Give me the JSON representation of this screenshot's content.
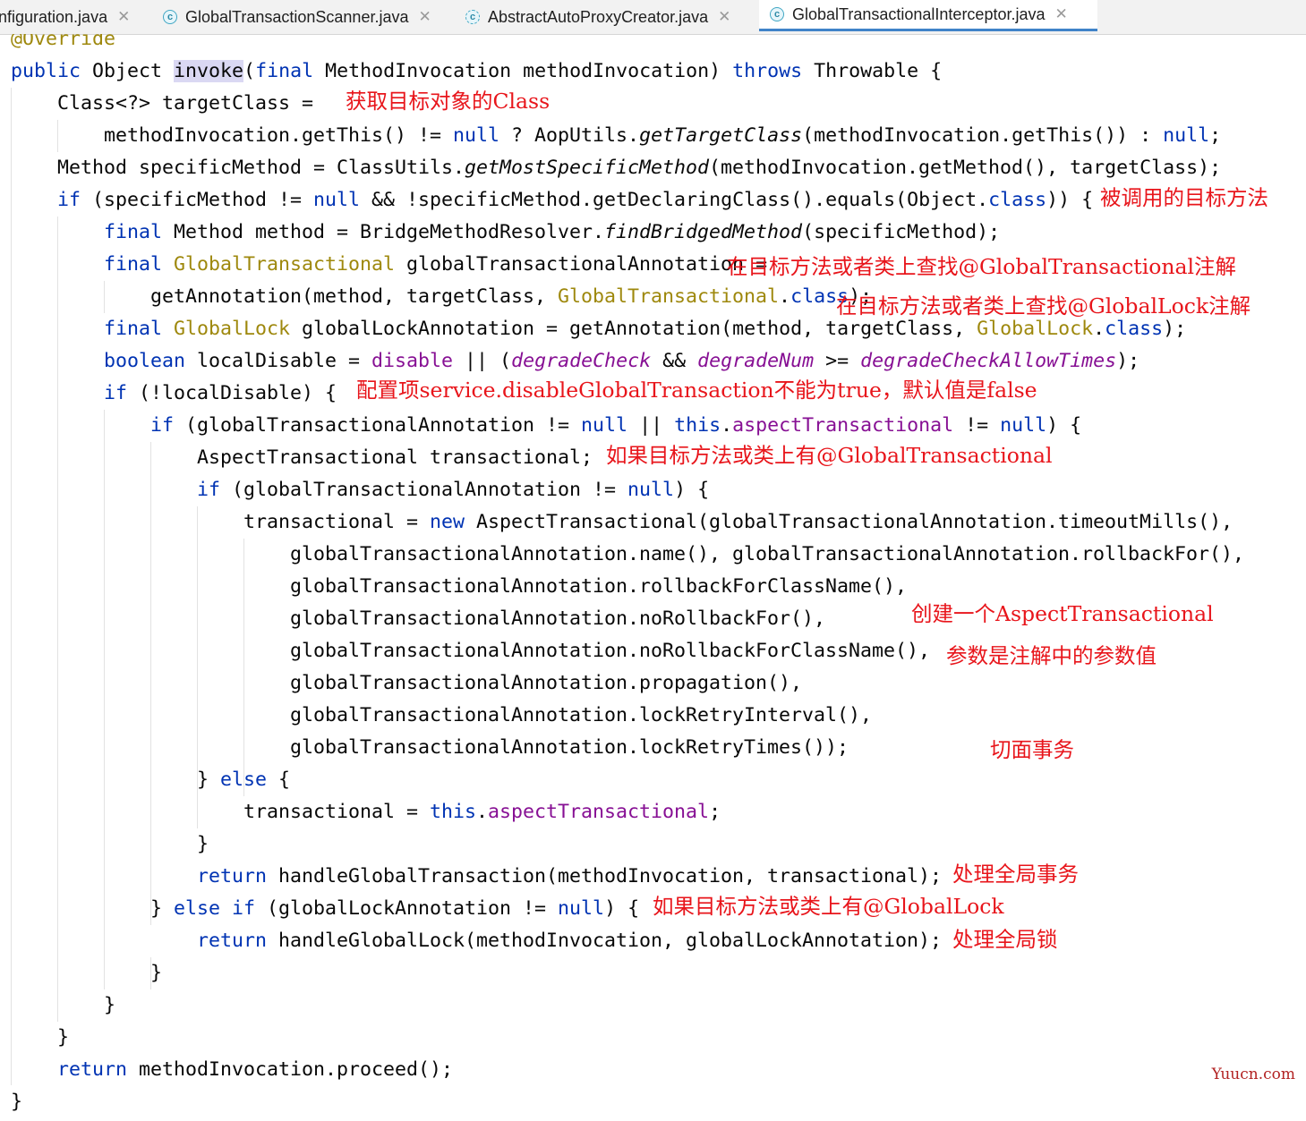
{
  "tabs": [
    {
      "label": "nfiguration.java",
      "icon": "none",
      "active": false
    },
    {
      "label": "GlobalTransactionScanner.java",
      "icon": "class-icon",
      "active": false
    },
    {
      "label": "AbstractAutoProxyCreator.java",
      "icon": "abstract-class-icon",
      "active": false
    },
    {
      "label": "GlobalTransactionalInterceptor.java",
      "icon": "class-icon",
      "active": true
    }
  ],
  "tab_close_glyph": "✕",
  "code_lines": [
    "@Override",
    "public Object invoke(final MethodInvocation methodInvocation) throws Throwable {",
    "    Class<?> targetClass =",
    "        methodInvocation.getThis() != null ? AopUtils.getTargetClass(methodInvocation.getThis()) : null;",
    "    Method specificMethod = ClassUtils.getMostSpecificMethod(methodInvocation.getMethod(), targetClass);",
    "    if (specificMethod != null && !specificMethod.getDeclaringClass().equals(Object.class)) {",
    "        final Method method = BridgeMethodResolver.findBridgedMethod(specificMethod);",
    "        final GlobalTransactional globalTransactionalAnnotation =",
    "            getAnnotation(method, targetClass, GlobalTransactional.class);",
    "        final GlobalLock globalLockAnnotation = getAnnotation(method, targetClass, GlobalLock.class);",
    "        boolean localDisable = disable || (degradeCheck && degradeNum >= degradeCheckAllowTimes);",
    "        if (!localDisable) {",
    "            if (globalTransactionalAnnotation != null || this.aspectTransactional != null) {",
    "                AspectTransactional transactional;",
    "                if (globalTransactionalAnnotation != null) {",
    "                    transactional = new AspectTransactional(globalTransactionalAnnotation.timeoutMills(),",
    "                        globalTransactionalAnnotation.name(), globalTransactionalAnnotation.rollbackFor(),",
    "                        globalTransactionalAnnotation.rollbackForClassName(),",
    "                        globalTransactionalAnnotation.noRollbackFor(),",
    "                        globalTransactionalAnnotation.noRollbackForClassName(),",
    "                        globalTransactionalAnnotation.propagation(),",
    "                        globalTransactionalAnnotation.lockRetryInterval(),",
    "                        globalTransactionalAnnotation.lockRetryTimes());",
    "                } else {",
    "                    transactional = this.aspectTransactional;",
    "                }",
    "                return handleGlobalTransaction(methodInvocation, transactional);",
    "            } else if (globalLockAnnotation != null) {",
    "                return handleGlobalLock(methodInvocation, globalLockAnnotation);",
    "            }",
    "        }",
    "    }",
    "    return methodInvocation.proceed();",
    "}"
  ],
  "annotations": [
    "获取目标对象的Class",
    "被调用的目标方法",
    "在目标方法或者类上查找@GlobalTransactional注解",
    "在目标方法或者类上查找@GlobalLock注解",
    "配置项service.disableGlobalTransaction不能为true，默认值是false",
    "如果目标方法或类上有@GlobalTransactional",
    "创建一个AspectTransactional",
    "参数是注解中的参数值",
    "切面事务",
    "处理全局事务",
    "如果目标方法或类上有@GlobalLock",
    "处理全局锁"
  ],
  "watermark": "Yuucn.com",
  "colors": {
    "keyword": "#0033b3",
    "annotation_class": "#9e880d",
    "field": "#871094",
    "comment_note": "#e8151b",
    "tab_active_underline": "#4083c9",
    "identifier_highlight": "#dad8f3"
  }
}
